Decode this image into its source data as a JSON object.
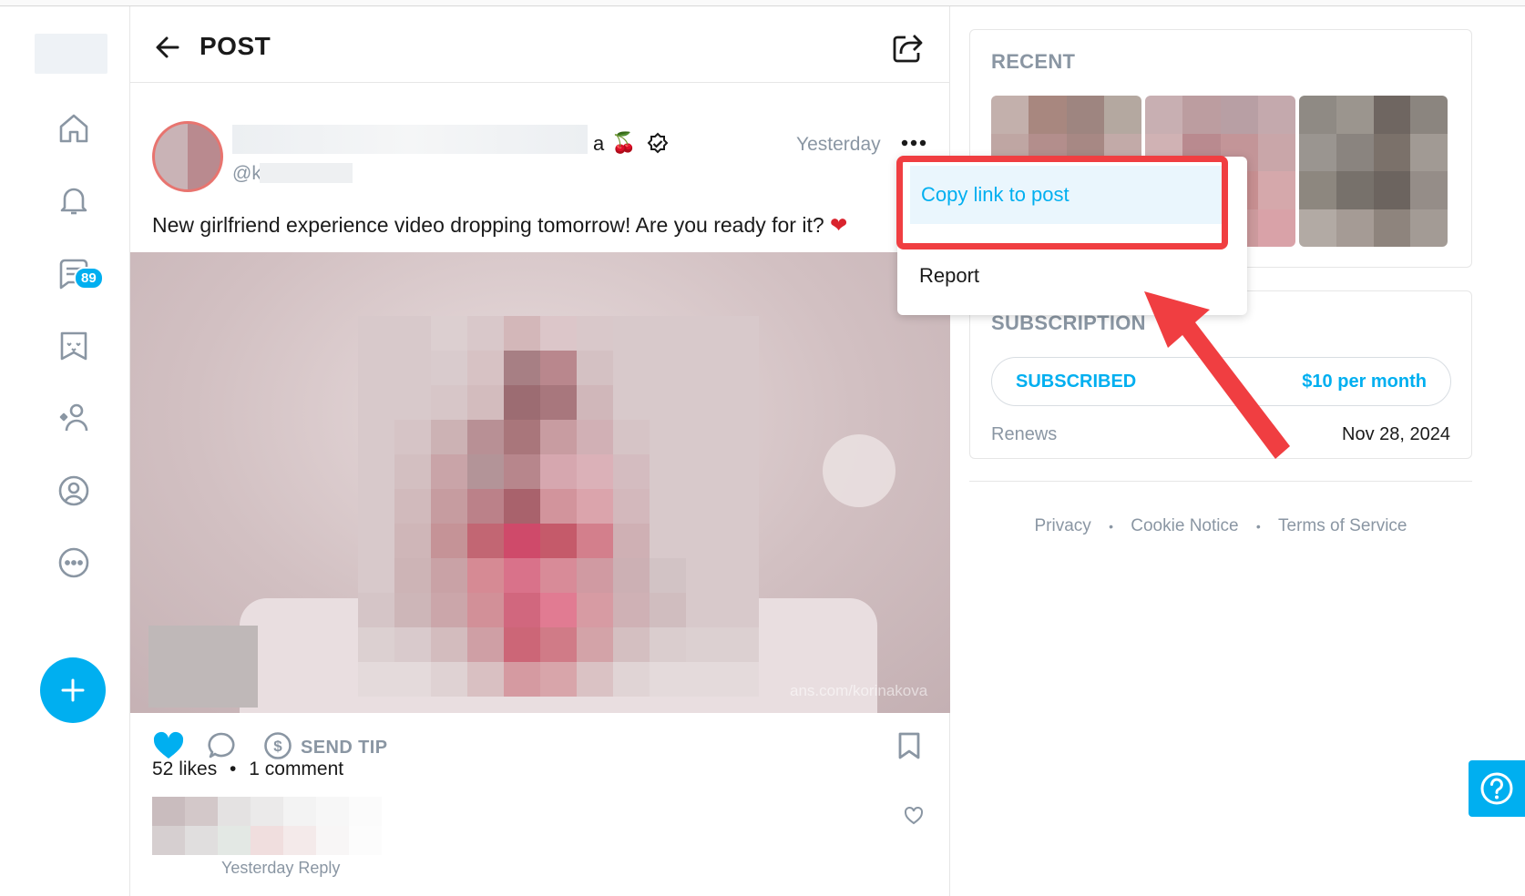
{
  "nav": {
    "items": [
      {
        "name": "home-icon"
      },
      {
        "name": "bell-icon"
      },
      {
        "name": "messages-icon"
      },
      {
        "name": "collections-icon"
      },
      {
        "name": "subscriptions-icon"
      },
      {
        "name": "profile-icon"
      },
      {
        "name": "more-icon"
      }
    ],
    "messages_badge": "89",
    "new_post_icon": "plus-icon"
  },
  "header": {
    "title": "POST"
  },
  "post": {
    "name_suffix": "a",
    "name_emoji": "🍒",
    "handle_prefix": "@k",
    "timestamp": "Yesterday",
    "caption": "New girlfriend experience video dropping tomorrow! Are you ready for it?",
    "caption_emoji": "❤",
    "watermark": "ans.com/korinakova",
    "actions": {
      "send_tip_label": "SEND TIP"
    },
    "likes": "52 likes",
    "separator": "•",
    "comments": "1 comment",
    "comment_meta": "Yesterday     Reply"
  },
  "dropdown": {
    "copy_link_label": "Copy link to post",
    "report_label": "Report"
  },
  "sidebar_right": {
    "recent_title": "RECENT",
    "subscription_title": "SUBSCRIPTION",
    "sub_status": "SUBSCRIBED",
    "sub_price": "$10 per month",
    "renews_label": "Renews",
    "renews_date": "Nov 28, 2024",
    "footer": {
      "privacy": "Privacy",
      "cookie": "Cookie Notice",
      "terms": "Terms of Service",
      "dot": "•"
    }
  },
  "colors": {
    "accent": "#00aff0",
    "highlight": "#f03e41",
    "muted": "#8a96a3"
  }
}
